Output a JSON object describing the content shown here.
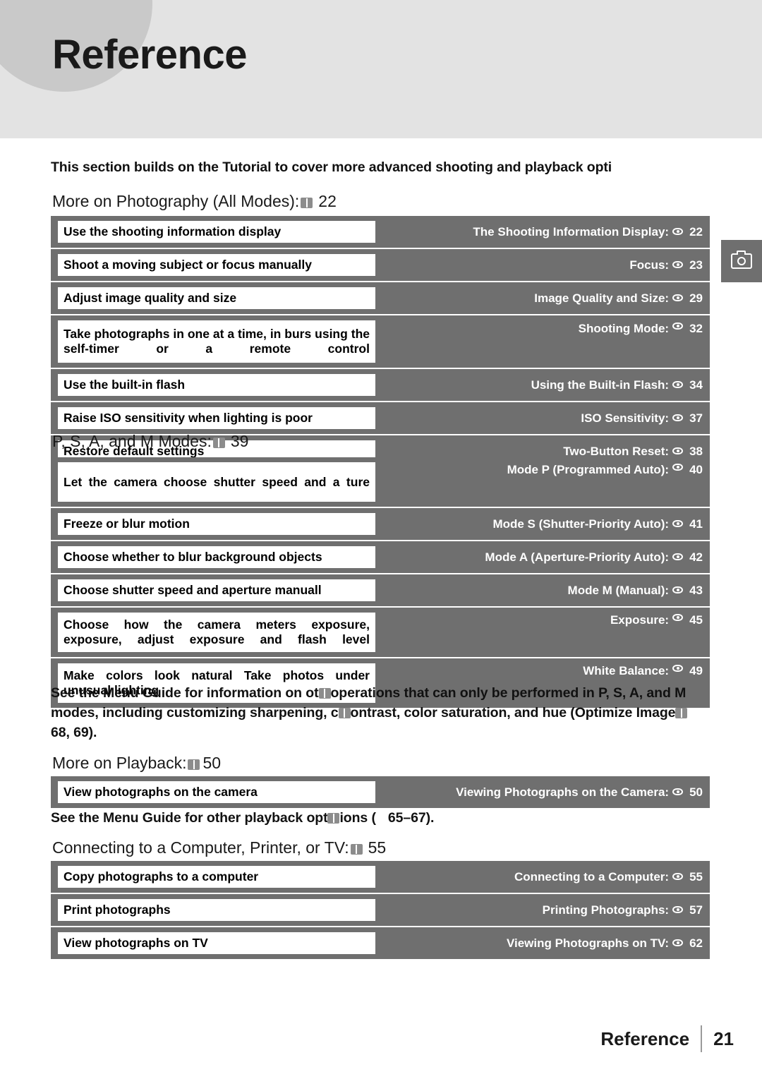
{
  "page": {
    "title": "Reference",
    "footer_label": "Reference",
    "footer_page": "21",
    "intro": "This section builds on the Tutorial to cover more advanced shooting and playback opti"
  },
  "sections": [
    {
      "heading": "More on Photography (All Modes):",
      "heading_page": "22",
      "rows": [
        {
          "left": "Use the shooting information display",
          "right": "The Shooting Information Display:",
          "page": "22"
        },
        {
          "left": "Shoot a moving subject or focus manually",
          "right": "Focus:",
          "page": "23"
        },
        {
          "left": "Adjust image quality and size",
          "right": "Image Quality and Size:",
          "page": "29"
        },
        {
          "left": "Take photographs in one at a time, in burs using the self-timer or a remote control",
          "right": "Shooting Mode:",
          "page": "32"
        },
        {
          "left": "Use the built-in flash",
          "right": "Using the Built-in Flash:",
          "page": "34"
        },
        {
          "left": "Raise ISO sensitivity when lighting is poor",
          "right": "ISO Sensitivity:",
          "page": "37"
        },
        {
          "left": "Restore default settings",
          "right": "Two-Button Reset:",
          "page": "38"
        }
      ]
    },
    {
      "heading": "P, S, A, and M Modes:",
      "heading_page": "39",
      "rows": [
        {
          "left": "Let the camera choose shutter speed and a ture",
          "right": "Mode P (Programmed Auto):",
          "page": "40"
        },
        {
          "left": "Freeze or blur motion",
          "right": "Mode S (Shutter-Priority Auto):",
          "page": "41"
        },
        {
          "left": "Choose whether to blur background objects",
          "right": "Mode A (Aperture-Priority Auto):",
          "page": "42"
        },
        {
          "left": "Choose shutter speed and aperture manuall",
          "right": "Mode M (Manual):",
          "page": "43"
        },
        {
          "left": "Choose how the camera meters exposure, exposure, adjust exposure and flash level",
          "right": "Exposure:",
          "page": "45"
        },
        {
          "left": "Make colors look natural Take photos under unusual lighting",
          "right": "White Balance:",
          "page": "49"
        }
      ]
    },
    {
      "heading": "More on Playback:",
      "heading_page": "50",
      "rows": [
        {
          "left": "View photographs on the camera",
          "right": "Viewing Photographs on the Camera:",
          "page": "50"
        }
      ]
    },
    {
      "heading": "Connecting to a Computer, Printer, or TV:",
      "heading_page": "55",
      "rows": [
        {
          "left": "Copy photographs to a computer",
          "right": "Connecting to a Computer:",
          "page": "55"
        },
        {
          "left": "Print photographs",
          "right": "Printing Photographs:",
          "page": "57"
        },
        {
          "left": "View photographs on TV",
          "right": "Viewing Photographs on TV:",
          "page": "62"
        }
      ]
    }
  ],
  "notes": {
    "psam_note_line1_a": "See the Menu Guide for information on ot",
    "psam_note_line1_b": "operations that can only be performed in ",
    "psam_note_line1_c": "P, S, A, and M",
    "psam_note_line2_a": "modes, including customizing sharpening, c",
    "psam_note_line2_b": "ontrast, color saturation, and hue (",
    "psam_note_line2_c": "Optimize Image",
    "psam_note_line3": "68, 69).",
    "playback_note_a": "See the Menu Guide for other playback opt",
    "playback_note_b": "ions (",
    "playback_note_c": "65–67)."
  }
}
